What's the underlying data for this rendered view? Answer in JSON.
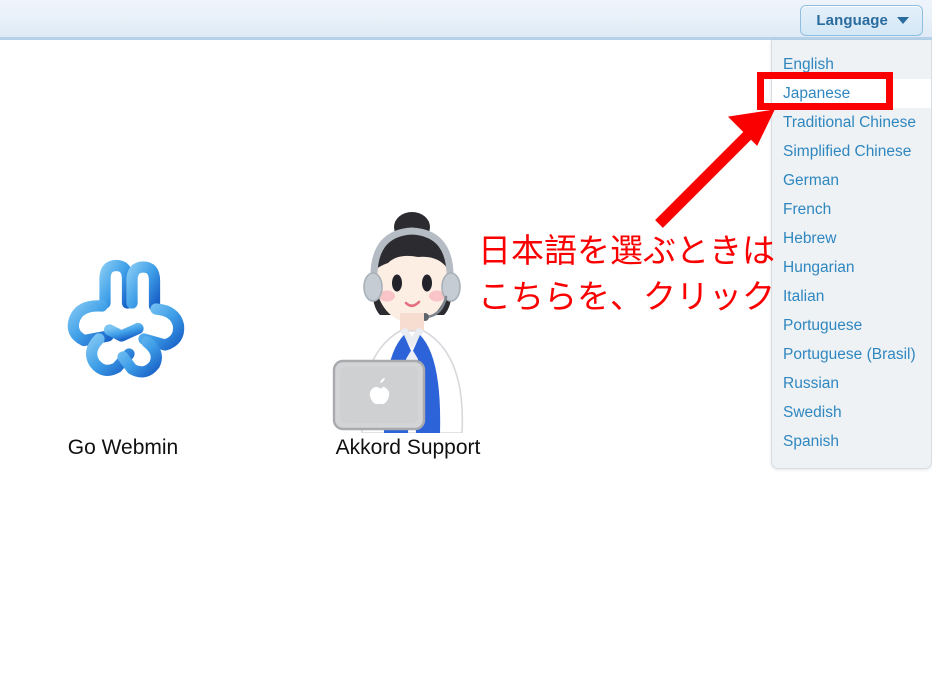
{
  "header": {
    "language_button_label": "Language",
    "caret_icon": "chevron-down-icon"
  },
  "language_menu": {
    "items": [
      "English",
      "Japanese",
      "Traditional Chinese",
      "Simplified Chinese",
      "German",
      "French",
      "Hebrew",
      "Hungarian",
      "Italian",
      "Portuguese",
      "Portuguese (Brasil)",
      "Russian",
      "Swedish",
      "Spanish"
    ],
    "highlighted_item": "Japanese"
  },
  "main": {
    "tiles": [
      {
        "label": "Go Webmin",
        "icon": "webmin-logo-icon"
      },
      {
        "label": "Akkord Support",
        "icon": "support-operator-icon"
      }
    ]
  },
  "annotation": {
    "line1": "日本語を選ぶときは",
    "line2": "こちらを、クリック",
    "text": "日本語を選ぶときは\nこちらを、クリック",
    "color": "#fb0000",
    "arrow": "red-arrow-pointing-to-japanese"
  },
  "colors": {
    "accent_blue": "#2f87c0",
    "header_border": "#b5d2e9",
    "annotation_red": "#fb0000",
    "menu_background": "#eef2f5",
    "button_text": "#2a6c9e"
  }
}
